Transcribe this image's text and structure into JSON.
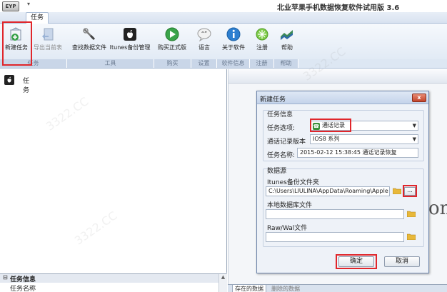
{
  "window": {
    "title": "北业苹果手机数据恢复软件试用版 3.6",
    "logo_text": "EYP"
  },
  "ribbon": {
    "tab_label": "任务",
    "buttons": [
      {
        "label": "新建任务",
        "icon": "new-task-icon",
        "enabled": true
      },
      {
        "label": "导出当前表",
        "icon": "export-icon",
        "enabled": false
      },
      {
        "label": "查找数据文件",
        "icon": "search-file-icon",
        "enabled": true
      },
      {
        "label": "Itunes备份管理",
        "icon": "itunes-backup-icon",
        "enabled": true
      },
      {
        "label": "购买正式版",
        "icon": "buy-icon",
        "enabled": true
      },
      {
        "label": "语言",
        "icon": "language-icon",
        "enabled": true
      },
      {
        "label": "关于软件",
        "icon": "about-icon",
        "enabled": true
      },
      {
        "label": "注册",
        "icon": "register-icon",
        "enabled": true
      },
      {
        "label": "帮助",
        "icon": "help-icon",
        "enabled": true
      }
    ],
    "groups": [
      "任务",
      "工具",
      "购买",
      "设置",
      "软件信息",
      "注册",
      "帮助"
    ]
  },
  "tree": {
    "items": [
      {
        "label": "任务",
        "icon": "apple-icon"
      }
    ]
  },
  "properties": {
    "header": "任务信息",
    "toggle": "⊟",
    "row_label": "任务名称"
  },
  "right_pane": {
    "tabs": [
      "存在的数据",
      "删除的数据"
    ],
    "background_text": "on"
  },
  "dialog": {
    "title": "新建任务",
    "close_label": "x",
    "task_info_label": "任务信息",
    "task_option_label": "任务选项:",
    "task_option_value": "通话记录",
    "version_label": "通话记录版本",
    "version_value": "IOS8 系列",
    "task_name_label": "任务名称:",
    "task_name_value": "2015-02-12 15:38:45 通话记录恢复",
    "datasource_label": "数据源",
    "itunes_folder_label": "Itunes备份文件夹",
    "itunes_folder_value": "C:\\Users\\LIULINA\\AppData\\Roaming\\Apple Compu",
    "browse_label": "...",
    "local_db_label": "本地数据库文件",
    "raw_wal_label": "Raw/Wal文件",
    "ok_label": "确定",
    "cancel_label": "取消"
  },
  "colors": {
    "highlight": "#e0262b",
    "ribbon_bg": "#dde7f3",
    "dialog_bg": "#eef2f8"
  }
}
